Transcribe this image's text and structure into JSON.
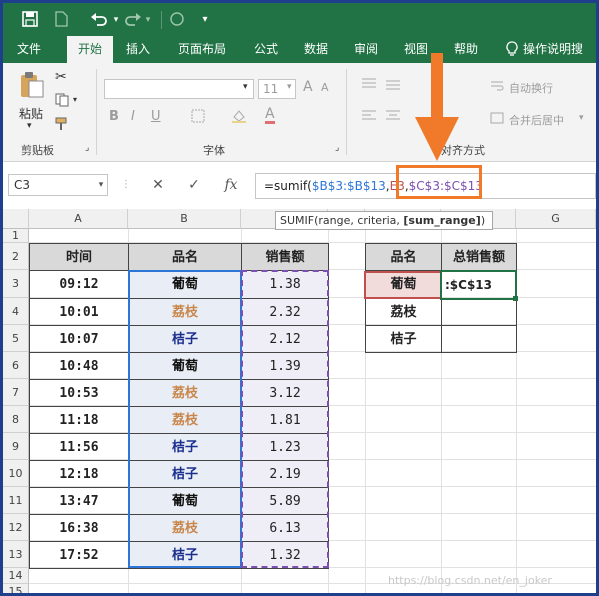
{
  "quick_access": {
    "save_icon": "save-icon",
    "new_icon": "new-doc-icon",
    "undo_icon": "undo-icon",
    "redo_icon": "redo-icon"
  },
  "tabs": [
    {
      "label": "文件",
      "active": false
    },
    {
      "label": "开始",
      "active": true
    },
    {
      "label": "插入",
      "active": false
    },
    {
      "label": "页面布局",
      "active": false
    },
    {
      "label": "公式",
      "active": false
    },
    {
      "label": "数据",
      "active": false
    },
    {
      "label": "审阅",
      "active": false
    },
    {
      "label": "视图",
      "active": false
    },
    {
      "label": "帮助",
      "active": false
    }
  ],
  "tell_me": "操作说明搜",
  "ribbon": {
    "paste_label": "粘贴",
    "clipboard_group": "剪贴板",
    "font_group": "字体",
    "alignment_group": "对齐方式",
    "font_size": "11",
    "wrap_text": "自动换行",
    "merge_center": "合并后居中",
    "bold": "B",
    "italic": "I",
    "underline": "U",
    "font_color": "A"
  },
  "formula_bar": {
    "name_box": "C3",
    "formula_prefix": "=sumif(",
    "arg1": "$B$3:$B$13",
    "comma1": ",",
    "arg2": "E3",
    "comma2": ",",
    "arg3": "$C$3:$C$13",
    "cancel": "✕",
    "enter": "✓",
    "fx": "fx"
  },
  "tooltip": {
    "func": "SUMIF(range, criteria, ",
    "current_arg": "[sum_range]",
    "close": ")"
  },
  "columns": [
    "A",
    "B",
    "C",
    "D",
    "E",
    "F",
    "G"
  ],
  "rows": [
    "1",
    "2",
    "3",
    "4",
    "5",
    "6",
    "7",
    "8",
    "9",
    "10",
    "11",
    "12",
    "13",
    "14",
    "15"
  ],
  "table": {
    "headers": [
      "时间",
      "品名",
      "销售额"
    ],
    "rows": [
      {
        "time": "09:12",
        "name": "葡萄",
        "sales": "1.38",
        "kind": "grape"
      },
      {
        "time": "10:01",
        "name": "荔枝",
        "sales": "2.32",
        "kind": "lychee"
      },
      {
        "time": "10:07",
        "name": "桔子",
        "sales": "2.12",
        "kind": "orange"
      },
      {
        "time": "10:48",
        "name": "葡萄",
        "sales": "1.39",
        "kind": "grape"
      },
      {
        "time": "10:53",
        "name": "荔枝",
        "sales": "3.12",
        "kind": "lychee"
      },
      {
        "time": "11:18",
        "name": "荔枝",
        "sales": "1.81",
        "kind": "lychee"
      },
      {
        "time": "11:56",
        "name": "桔子",
        "sales": "1.23",
        "kind": "orange"
      },
      {
        "time": "12:18",
        "name": "桔子",
        "sales": "2.19",
        "kind": "orange"
      },
      {
        "time": "13:47",
        "name": "葡萄",
        "sales": "5.89",
        "kind": "grape"
      },
      {
        "time": "16:38",
        "name": "荔枝",
        "sales": "6.13",
        "kind": "lychee"
      },
      {
        "time": "17:52",
        "name": "桔子",
        "sales": "1.32",
        "kind": "orange"
      }
    ]
  },
  "summary": {
    "headers": [
      "品名",
      "总销售额"
    ],
    "rows": [
      {
        "name": "葡萄",
        "value": ":$C$13"
      },
      {
        "name": "荔枝",
        "value": ""
      },
      {
        "name": "桔子",
        "value": ""
      }
    ]
  },
  "colors": {
    "excel_green": "#217346",
    "grape": "#111111",
    "lychee": "#c8864a",
    "orange": "#1a2f8f",
    "highlight": "#f07a2a",
    "range_blue": "#2e75d8",
    "range_purple": "#7c4fb2",
    "range_red": "#c0504d"
  },
  "watermark": "https://blog.csdn.net/en_joker"
}
